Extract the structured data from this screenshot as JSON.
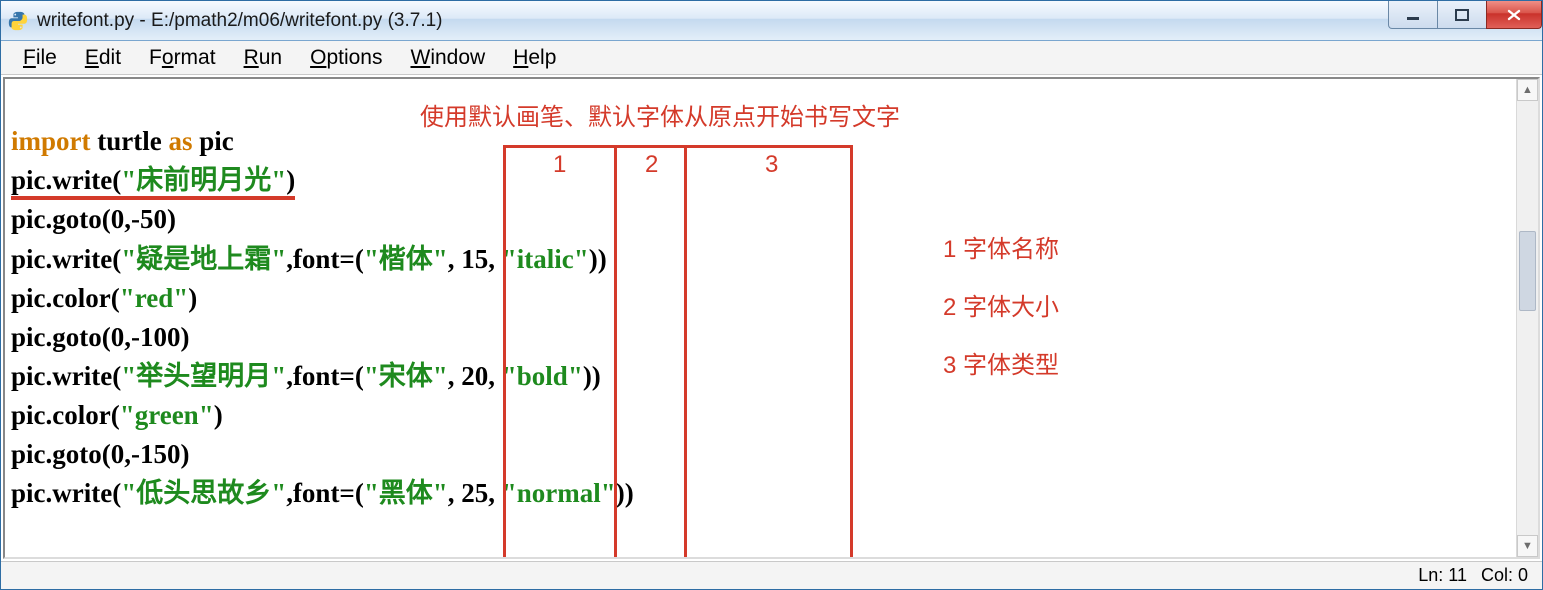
{
  "window": {
    "title": "writefont.py - E:/pmath2/m06/writefont.py (3.7.1)"
  },
  "menu": {
    "file": {
      "label": "File",
      "hotkey": "F"
    },
    "edit": {
      "label": "Edit",
      "hotkey": "E"
    },
    "format": {
      "label": "Format",
      "hotkey": "o"
    },
    "run": {
      "label": "Run",
      "hotkey": "R"
    },
    "options": {
      "label": "Options",
      "hotkey": "O"
    },
    "window": {
      "label": "Window",
      "hotkey": "W"
    },
    "help": {
      "label": "Help",
      "hotkey": "H"
    }
  },
  "code": {
    "l1": {
      "import": "import",
      "turtle": " turtle ",
      "as": "as",
      "pic": " pic"
    },
    "l2": {
      "prefix": "pic.write(",
      "str": "\"床前明月光\"",
      "suffix": ")"
    },
    "l3": "pic.goto(0,-50)",
    "l4": {
      "prefix": "pic.write(",
      "str1": "\"疑是地上霜\"",
      "mid": ",font=(",
      "str2": "\"楷体\"",
      "c1": ", 15, ",
      "str3": "\"italic\"",
      "end": "))"
    },
    "l5": {
      "prefix": "pic.color(",
      "str": "\"red\"",
      "suffix": ")"
    },
    "l6": "pic.goto(0,-100)",
    "l7": {
      "prefix": "pic.write(",
      "str1": "\"举头望明月\"",
      "mid": ",font=(",
      "str2": "\"宋体\"",
      "c1": ", 20, ",
      "str3": "\"bold\"",
      "end": "))"
    },
    "l8": {
      "prefix": "pic.color(",
      "str": "\"green\"",
      "suffix": ")"
    },
    "l9": "pic.goto(0,-150)",
    "l10": {
      "prefix": "pic.write(",
      "str1": "\"低头思故乡\"",
      "mid": ",font=(",
      "str2": "\"黑体\"",
      "c1": ", 25, ",
      "str3": "\"normal\"",
      "end": "))"
    }
  },
  "annotations": {
    "title": "使用默认画笔、默认字体从原点开始书写文字",
    "columns": {
      "1": "1",
      "2": "2",
      "3": "3"
    },
    "legend": {
      "1": "1  字体名称",
      "2": "2  字体大小",
      "3": "3  字体类型"
    }
  },
  "status": {
    "ln": "Ln: 11",
    "col": "Col: 0"
  }
}
